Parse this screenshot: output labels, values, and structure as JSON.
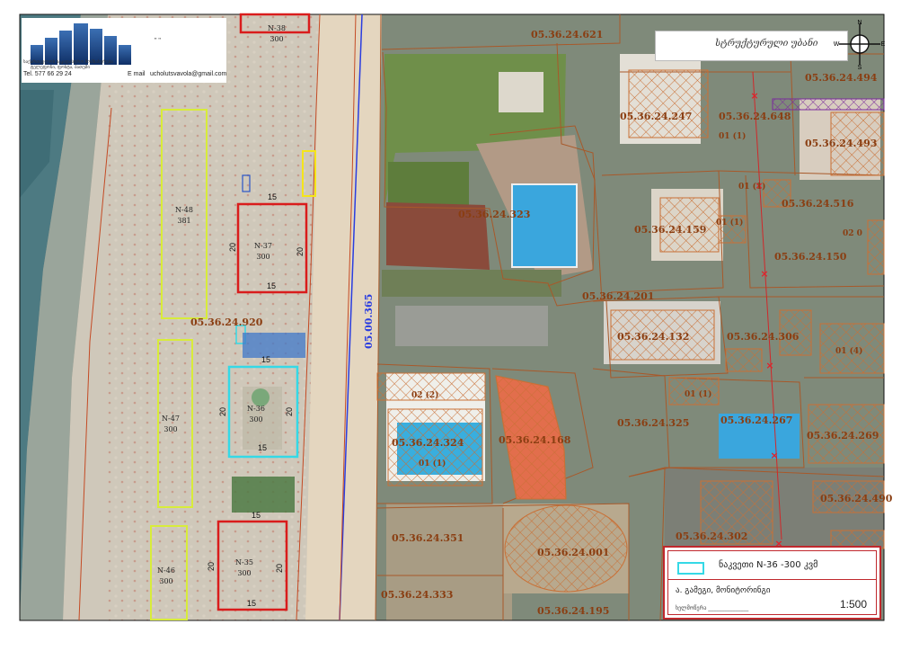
{
  "colors": {
    "sea": "#4d7a82",
    "beach": "#c9c2b4",
    "parcel_line": "#a8592a",
    "parcel_label": "#8a3e12",
    "highlight_cyan": "#35d9e6",
    "kiosk_red": "#d91c1c",
    "zone_yellow": "#d8ec3a",
    "road_blue": "#2a3de0",
    "hatch_orange": "#c97036",
    "legend_border": "#c0282d"
  },
  "company": {
    "name_small": "საქართველოს საკადასტრო მომსახურება",
    "subtitle_small": "ტელეფონი, ფოსტა, ბათუმი",
    "phone": "Tel. 577 66 29 24",
    "email_label": "E mail",
    "email": "ucholutsvavola@gmail.com",
    "mark": "\" \""
  },
  "title_box": {
    "text": "სტრუქტურული უბანი"
  },
  "compass": {
    "n": "N",
    "s": "S",
    "e": "E",
    "w": "W"
  },
  "beach_kiosks": [
    {
      "label": "N-38",
      "area": "300"
    },
    {
      "label": "N-37",
      "area": "300",
      "w": "15",
      "h": "20"
    },
    {
      "label": "N-36",
      "area": "300",
      "w": "15",
      "h": "20"
    },
    {
      "label": "N-35",
      "area": "300",
      "w": "15",
      "h": "20"
    }
  ],
  "beach_zones": [
    {
      "label": "N-48",
      "area": "381"
    },
    {
      "label": "N-47",
      "area": "300"
    },
    {
      "label": "N-46",
      "area": "300"
    }
  ],
  "parcels": {
    "p621": "05.36.24.621",
    "p494": "05.36.24.494",
    "p247": "05.36.24.247",
    "p648": "05.36.24.648",
    "p493": "05.36.24.493",
    "p323": "05.36.24.323",
    "p516": "05.36.24.516",
    "p159": "05.36.24.159",
    "p150": "05.36.24.150",
    "p201": "05.36.24.201",
    "p920": "05.36.24.920",
    "p132": "05.36.24.132",
    "p306": "05.36.24.306",
    "p325": "05.36.24.325",
    "p267": "05.36.24.267",
    "p324": "05.36.24.324",
    "p168": "05.36.24.168",
    "p269": "05.36.24.269",
    "p490": "05.36.24.490",
    "p351": "05.36.24.351",
    "p001": "05.36.24.001",
    "p302": "05.36.24.302",
    "p333": "05.36.24.333",
    "p195": "05.36.24.195",
    "road": "05.00.365"
  },
  "sublabels": {
    "u01_a": "01 (1)",
    "u01_b": "01 (1)",
    "u01_c": "01 (1)",
    "u02": "02 (2)",
    "u01_d": "01 (1)",
    "u01_e": "01 (1)",
    "u01_4": "01 (4)",
    "u020": "02 0"
  },
  "legend": {
    "swatch_label": "ნაკვეთი N-36 -300 კვმ",
    "author": "ა. გამეგი, მონიტორინგი",
    "signature_line": "ხელმოწერა _______________",
    "scale": "1:500"
  }
}
